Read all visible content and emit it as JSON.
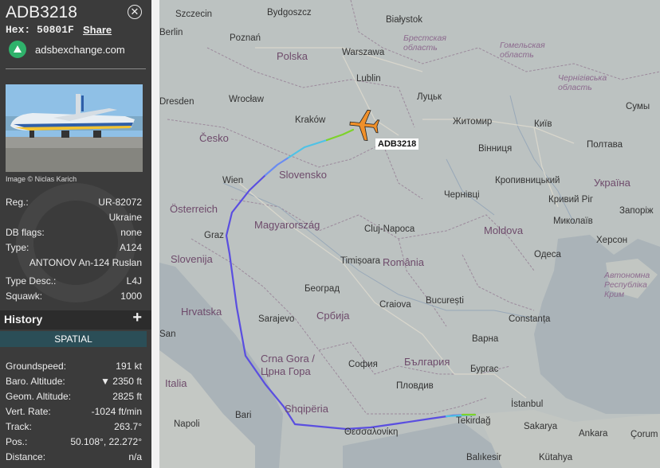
{
  "sidebar": {
    "callsign": "ADB3218",
    "hex_label": "Hex:",
    "hex_value": "50801F",
    "share_label": "Share",
    "source_name": "adsbexchange.com",
    "image_credit": "Image © Niclas Karich",
    "fields": [
      {
        "label": "Reg.:",
        "value": "UR-82072"
      },
      {
        "label": "",
        "value": "Ukraine"
      },
      {
        "label": "DB flags:",
        "value": "none"
      },
      {
        "label": "Type:",
        "value": "A124"
      },
      {
        "label": "",
        "value": "ANTONOV An-124 Ruslan"
      },
      {
        "label": "Type Desc.:",
        "value": "L4J"
      },
      {
        "label": "Squawk:",
        "value": "1000"
      }
    ],
    "history_title": "History",
    "spatial_label": "SPATIAL",
    "spatial": [
      {
        "label": "Groundspeed:",
        "value": "191 kt"
      },
      {
        "label": "Baro. Altitude:",
        "value": "▼ 2350 ft"
      },
      {
        "label": "Geom. Altitude:",
        "value": "2825 ft"
      },
      {
        "label": "Vert. Rate:",
        "value": "-1024 ft/min"
      },
      {
        "label": "Track:",
        "value": "263.7°"
      },
      {
        "label": "Pos.:",
        "value": "50.108°, 22.272°"
      },
      {
        "label": "Distance:",
        "value": "n/a"
      }
    ]
  },
  "map": {
    "aircraft_label": "ADB3218",
    "colors": {
      "track": "#5a4ee0",
      "aircraft": "#f0902a"
    },
    "labels": {
      "szczecin": "Szczecin",
      "bydgoszcz": "Bydgoszcz",
      "bialystok": "Białystok",
      "berlin": "Berlin",
      "poznan": "Poznań",
      "brest_region": "Брестская\nобласть",
      "gomel_region": "Гомельская\nобласть",
      "polska": "Polska",
      "warszawa": "Warszawa",
      "lublin": "Lublin",
      "lutsk": "Луцьк",
      "dresden": "Dresden",
      "wroclaw": "Wrocław",
      "chernihiv_region": "Чернігівська\nобласть",
      "sumy": "Сумы",
      "cesko": "Česko",
      "krakow": "Kraków",
      "zhytomyr": "Житомир",
      "kyiv": "Київ",
      "vinnytsia": "Вінниця",
      "poltava": "Полтава",
      "slovensko": "Slovensko",
      "wien": "Wien",
      "chernivtsi": "Чернівці",
      "kropyvnytskyi": "Кропивницький",
      "ukraina": "Україна",
      "osterreich": "Österreich",
      "kryvyi_rih": "Кривий Ріг",
      "zaporizhzhia": "Запоріж",
      "magyarorszag": "Magyarország",
      "cluj": "Cluj-Napoca",
      "mykolaiv": "Миколаїв",
      "moldova": "Moldova",
      "graz": "Graz",
      "kherson": "Херсон",
      "slovenija": "Slovenija",
      "timisoara": "Timișoara",
      "romania": "România",
      "odesa": "Одеса",
      "crimea": "Автономна\nРеспубліка\nКрим",
      "beograd": "Београд",
      "hrvatska": "Hrvatska",
      "craiova": "Craiova",
      "bucuresti": "București",
      "sarajevo": "Sarajevo",
      "srbija": "Србија",
      "constanta": "Constanța",
      "varna": "Варна",
      "crna_gora": "Crna Gora /\nЦрна Гора",
      "sofia": "София",
      "bulgaria": "България",
      "burgas": "Бургас",
      "italia": "Italia",
      "plovdiv": "Пловдив",
      "istanbul": "İstanbul",
      "bari": "Bari",
      "shqiperia": "Shqipëria",
      "tekirdag": "Tekirdağ",
      "sakarya": "Sakarya",
      "thessaloniki": "Θεσσαλονίκη",
      "napoli": "Napoli",
      "ankara": "Ankara",
      "corum": "Çorum",
      "balikesir": "Balıkesir",
      "kutahya": "Kütahya",
      "san": "San"
    }
  }
}
